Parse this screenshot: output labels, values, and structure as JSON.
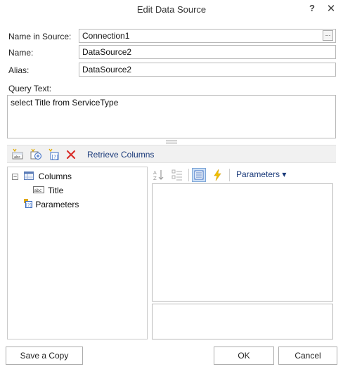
{
  "dialog": {
    "title": "Edit Data Source",
    "help_label": "?",
    "close_label": "✕"
  },
  "fields": {
    "name_in_source_label": "Name in Source:",
    "name_in_source_value": "Connection1",
    "name_label": "Name:",
    "name_value": "DataSource2",
    "alias_label": "Alias:",
    "alias_value": "DataSource2",
    "query_label": "Query Text:",
    "query_value": "select Title from ServiceType",
    "ellipsis_label": "..."
  },
  "toolbar": {
    "icons": [
      "new-column-icon",
      "calculated-column-icon",
      "new-parameter-icon",
      "delete-icon"
    ],
    "retrieve_label": "Retrieve Columns"
  },
  "tree": {
    "columns_label": "Columns",
    "columns_expander": "−",
    "title_label": "Title",
    "parameters_label": "Parameters"
  },
  "properties": {
    "parameters_dropdown": "Parameters ▾"
  },
  "buttons": {
    "save_copy": "Save a Copy",
    "ok": "OK",
    "cancel": "Cancel"
  }
}
